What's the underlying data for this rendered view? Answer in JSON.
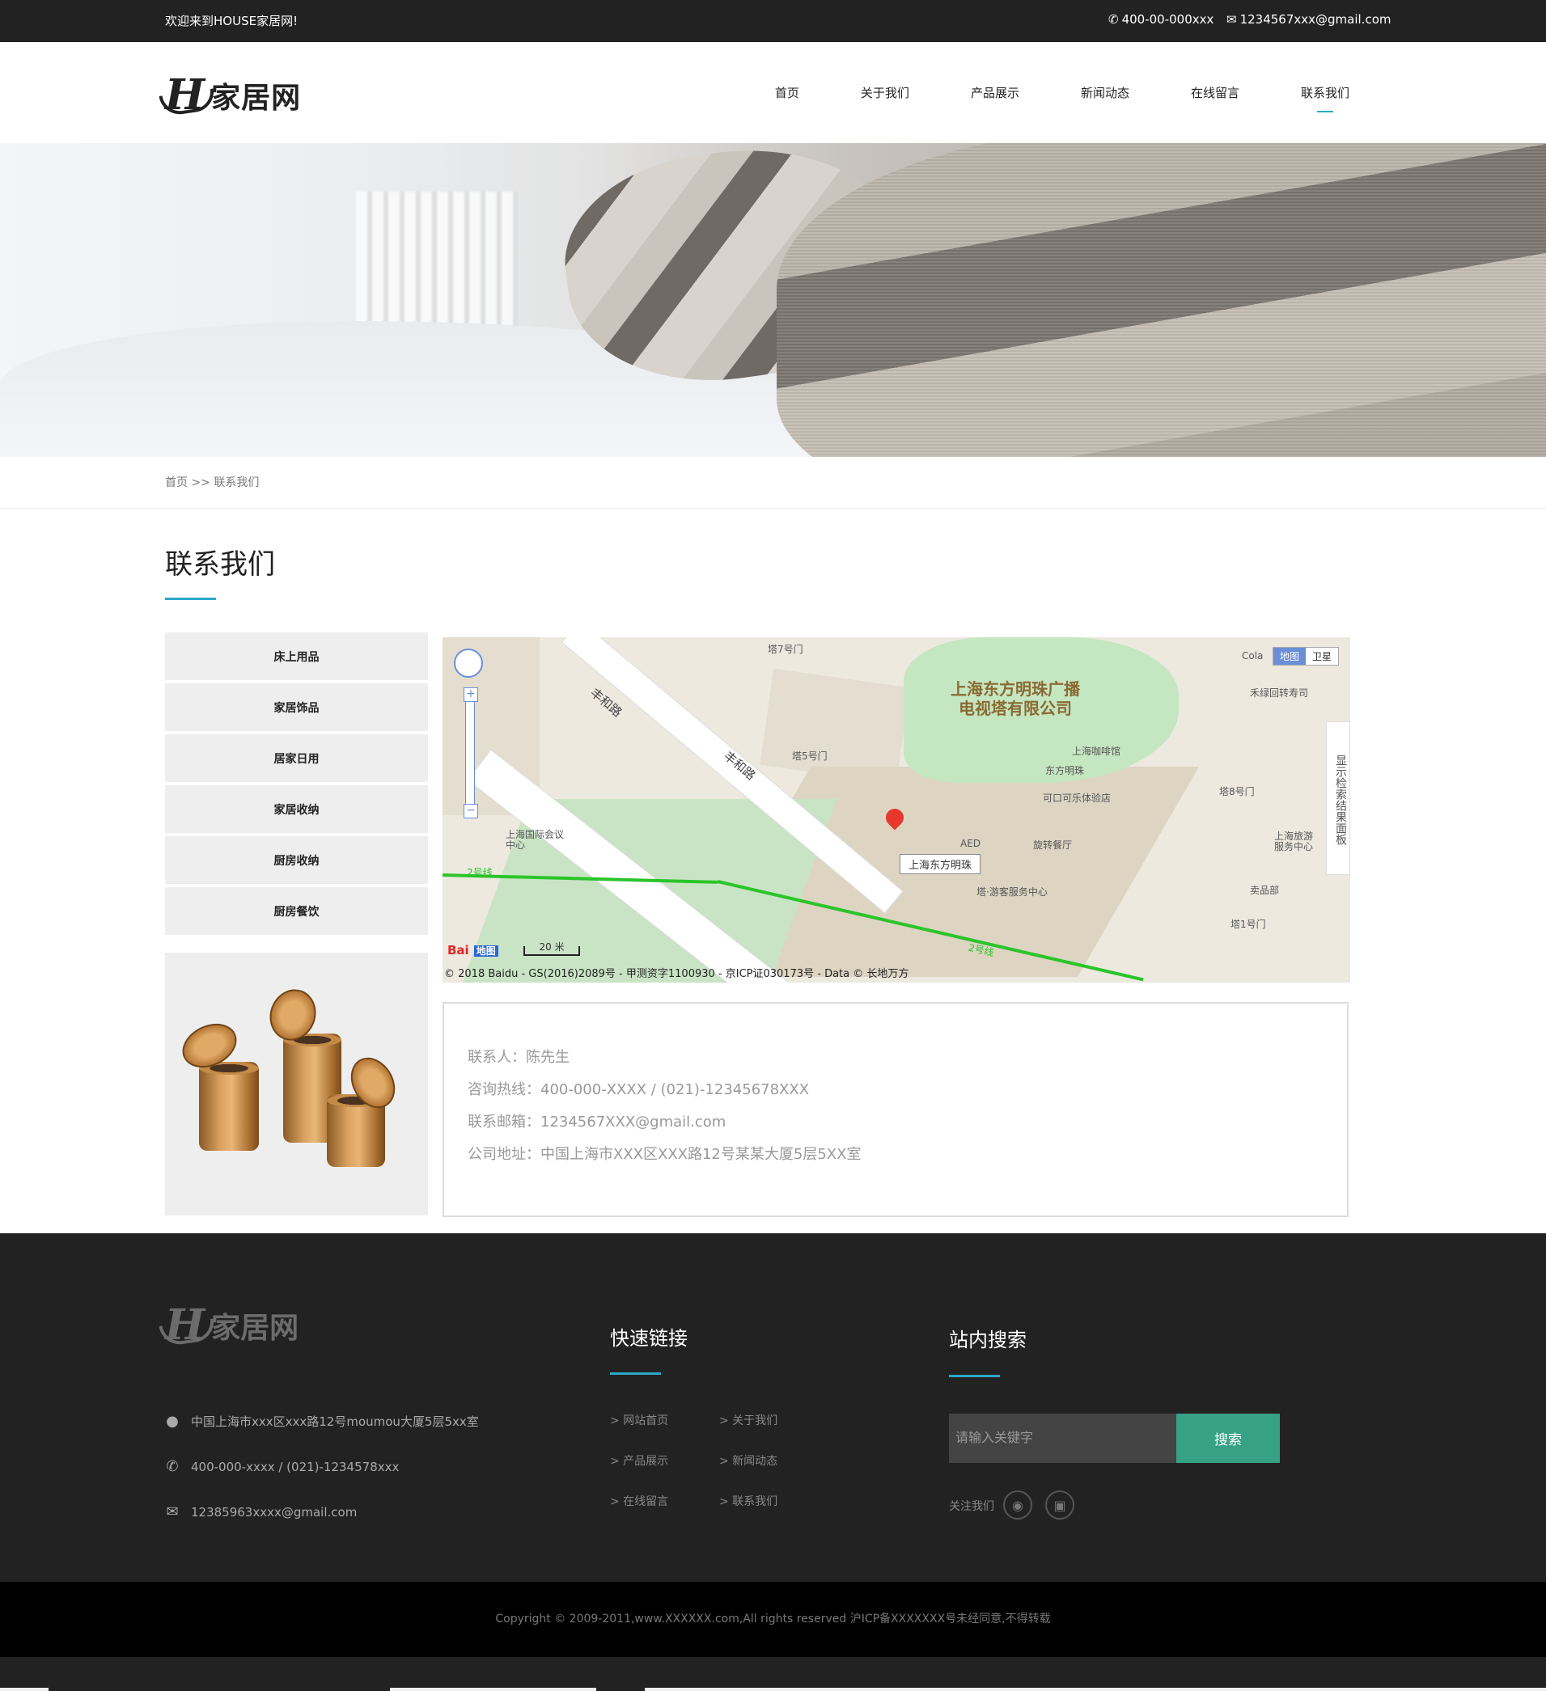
{
  "topbar": {
    "welcome": "欢迎来到HOUSE家居网!",
    "phone": "400-00-000xxx",
    "email": "1234567xxx@gmail.com"
  },
  "header": {
    "logo_mark": "H",
    "logo_name": "家居网",
    "nav": [
      {
        "label": "首页",
        "active": false
      },
      {
        "label": "关于我们",
        "active": false
      },
      {
        "label": "产品展示",
        "active": false
      },
      {
        "label": "新闻动态",
        "active": false
      },
      {
        "label": "在线留言",
        "active": false
      },
      {
        "label": "联系我们",
        "active": true
      }
    ],
    "accent_color": "#2aa9c9"
  },
  "breadcrumb": "首页 >> 联系我们",
  "page_title": "联系我们",
  "sidebar": {
    "categories": [
      "床上用品",
      "家居饰品",
      "居家日用",
      "家居收纳",
      "厨房收纳",
      "厨房餐饮"
    ]
  },
  "map": {
    "building_name_line1": "上海东方明珠广播",
    "building_name_line2": "电视塔有限公司",
    "poi_selected": "上海东方明珠",
    "road1": "丰和路",
    "road2": "丰和路",
    "metro_label": "2号线",
    "metro_label2": "2号线",
    "gate_top": "塔7号门",
    "gate_5": "塔5号门",
    "gate_8": "塔8号门",
    "gate_1": "塔1号门",
    "poi_cafe": "上海咖啡馆",
    "poi_pearl": "东方明珠",
    "poi_coke": "可口可乐体验店",
    "poi_aed": "AED",
    "poi_restaurant": "旋转餐厅",
    "poi_service": "塔·游客服务中心",
    "poi_shop": "卖品部",
    "poi_sushi": "禾绿回转寿司",
    "poi_cola": "Cola",
    "poi_conference": "上海国际会议中心",
    "poi_travel": "上海旅游服务中心",
    "maptype_map": "地图",
    "maptype_sat": "卫星",
    "side_panel": "显示检索结果面板",
    "scale": "20 米",
    "baidu_logo": "Bai",
    "baidu_logo2": "地图",
    "copyright": "© 2018 Baidu - GS(2016)2089号 - 甲测资字1100930 - 京ICP证030173号 - Data © 长地万方"
  },
  "contact": {
    "person": "联系人：陈先生",
    "hotline": "咨询热线：400-000-XXXX / (021)-12345678XXX",
    "email": "联系邮箱：1234567XXX@gmail.com",
    "address": "公司地址：中国上海市XXX区XXX路12号某某大厦5层5XX室"
  },
  "footer": {
    "logo_mark": "H",
    "logo_name": "家居网",
    "address": "中国上海市xxx区xxx路12号moumou大厦5层5xx室",
    "phone": "400-000-xxxx / (021)-1234578xxx",
    "email": "12385963xxxx@gmail.com",
    "quick_links_title": "快速链接",
    "quick_links": [
      "> 网站首页",
      "> 关于我们",
      "> 产品展示",
      "> 新闻动态",
      "> 在线留言",
      "> 联系我们"
    ],
    "search_title": "站内搜索",
    "search_placeholder": "请输入关键字",
    "search_button": "搜索",
    "follow_label": "关注我们",
    "search_button_color": "#36a185"
  },
  "copyright": "Copyright © 2009-2011,www.XXXXXX.com,All rights reserved 沪ICP备XXXXXXX号未经同意,不得转载"
}
